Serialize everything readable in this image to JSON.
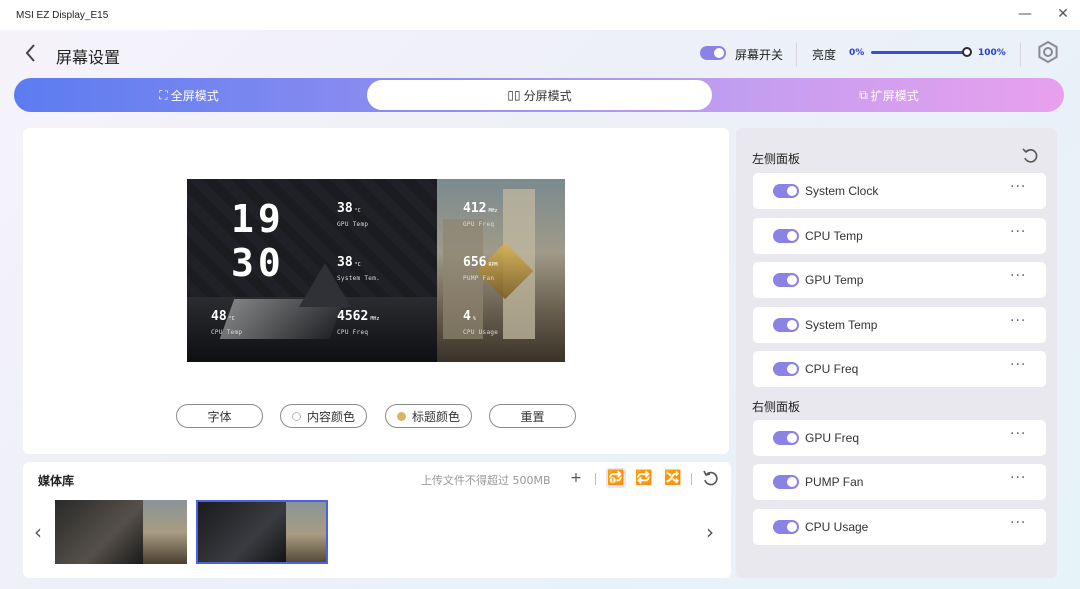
{
  "window": {
    "title": "MSI EZ Display_E15",
    "minimize": "—",
    "close": "✕"
  },
  "header": {
    "title": "屏幕设置",
    "screen_switch_label": "屏幕开关",
    "screen_switch_on": true,
    "brightness_label": "亮度",
    "brightness_min": "0%",
    "brightness_max": "100%",
    "brightness_level": 100
  },
  "tabs": [
    {
      "label": "全屏模式",
      "icon": "fullscreen-icon",
      "active": false
    },
    {
      "label": "分屏模式",
      "icon": "split-screen-icon",
      "active": true
    },
    {
      "label": "扩屏模式",
      "icon": "extend-screen-icon",
      "active": false
    }
  ],
  "preview": {
    "clock_hour": "19",
    "clock_minute": "30",
    "metrics": [
      {
        "value": "38",
        "unit": "°C",
        "label": "GPU Temp"
      },
      {
        "value": "38",
        "unit": "°C",
        "label": "System Tem."
      },
      {
        "value": "48",
        "unit": "°C",
        "label": "CPU Temp"
      },
      {
        "value": "4562",
        "unit": "MHz",
        "label": "CPU Freq"
      },
      {
        "value": "412",
        "unit": "MHz",
        "label": "GPU Freq"
      },
      {
        "value": "656",
        "unit": "RPM",
        "label": "PUMP Fan"
      },
      {
        "value": "4",
        "unit": "%",
        "label": "CPU Usage"
      }
    ]
  },
  "controls": {
    "font": "字体",
    "content_color": "内容颜色",
    "title_color": "标题颜色",
    "reset": "重置",
    "content_color_hex": "#ffffff",
    "title_color_hex": "#d8b36a"
  },
  "media": {
    "title": "媒体库",
    "upload_hint": "上传文件不得超过 500MB",
    "selected_index": 1
  },
  "right_panel": {
    "left_title": "左侧面板",
    "right_title": "右侧面板",
    "left_items": [
      "System Clock",
      "CPU Temp",
      "GPU Temp",
      "System Temp",
      "CPU Freq"
    ],
    "right_items": [
      "GPU Freq",
      "PUMP Fan",
      "CPU Usage"
    ],
    "more": "···"
  },
  "colors": {
    "accent": "#3a4bd6",
    "toggle": "#8b82e6"
  }
}
